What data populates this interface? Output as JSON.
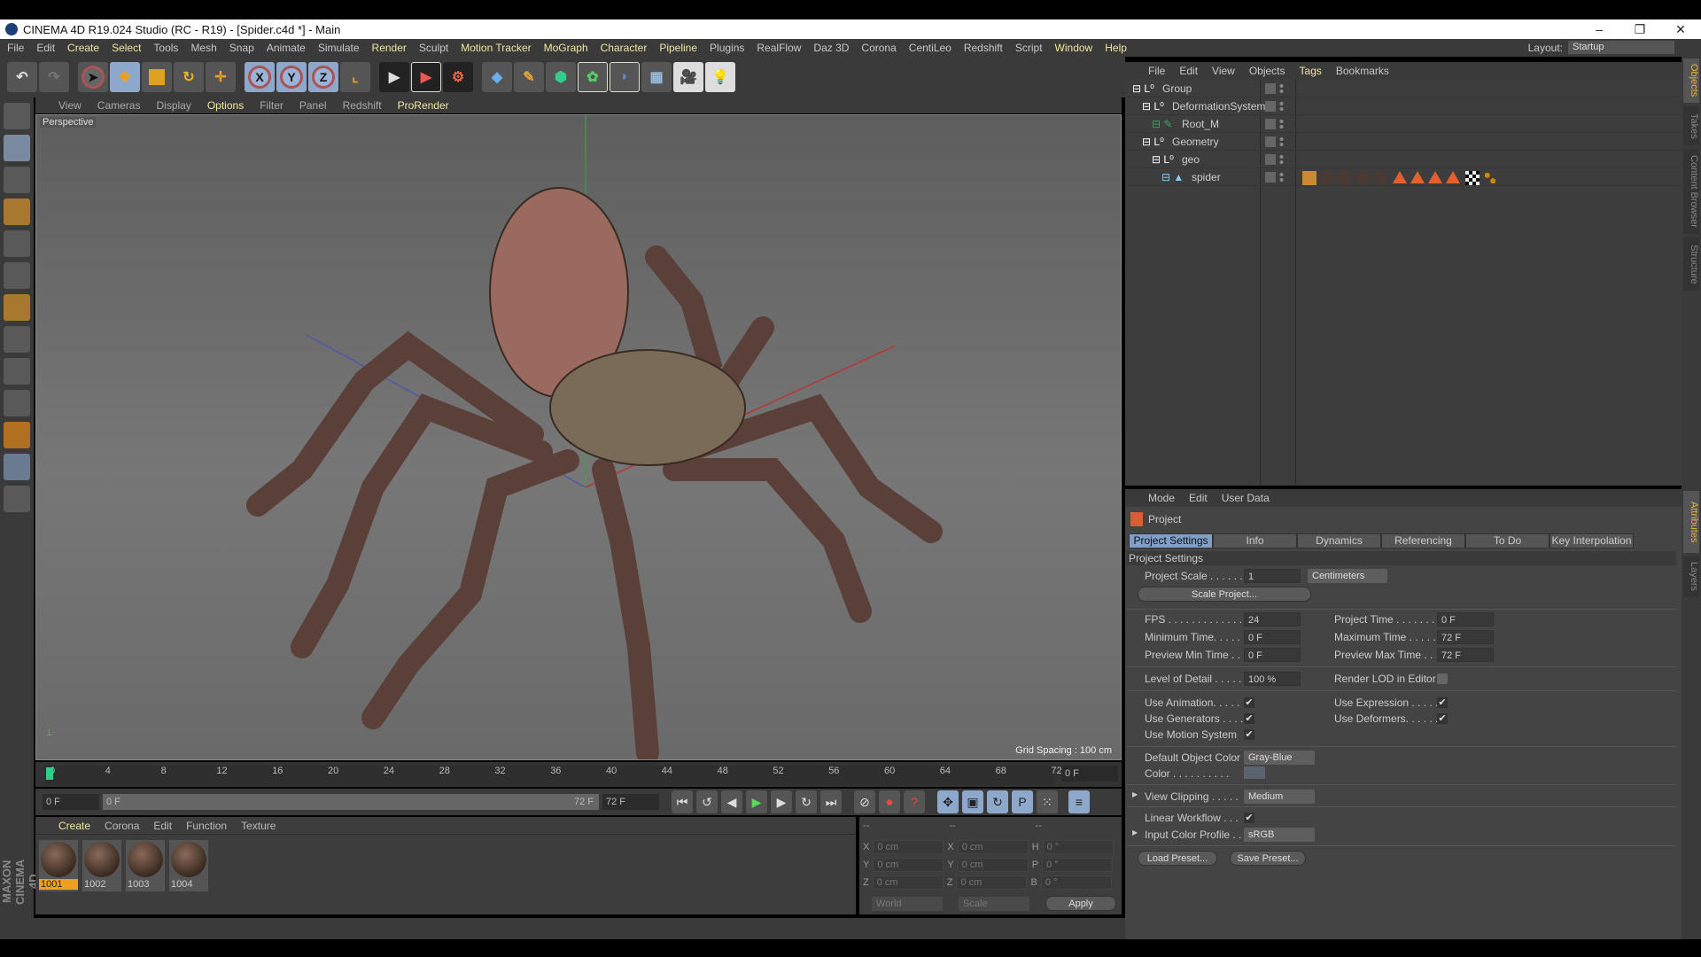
{
  "window": {
    "title": "CINEMA 4D R19.024 Studio (RC - R19) - [Spider.c4d *] - Main",
    "minimize": "–",
    "maximize": "❐",
    "close": "✕"
  },
  "menu": [
    "File",
    "Edit",
    "Create",
    "Select",
    "Tools",
    "Mesh",
    "Snap",
    "Animate",
    "Simulate",
    "Render",
    "Sculpt",
    "Motion Tracker",
    "MoGraph",
    "Character",
    "Pipeline",
    "Plugins",
    "RealFlow",
    "Daz 3D",
    "Corona",
    "CentiLeo",
    "Redshift",
    "Script",
    "Window",
    "Help"
  ],
  "layout": {
    "label": "Layout:",
    "value": "Startup"
  },
  "toolbar": {
    "x": "X",
    "y": "Y",
    "z": "Z"
  },
  "viewport": {
    "menu": [
      "View",
      "Cameras",
      "Display",
      "Options",
      "Filter",
      "Panel",
      "Redshift",
      "ProRender"
    ],
    "camera": "Perspective",
    "grid_spacing": "Grid Spacing : 100 cm"
  },
  "timeline": {
    "ticks": [
      "0",
      "4",
      "8",
      "12",
      "16",
      "20",
      "24",
      "28",
      "32",
      "36",
      "40",
      "44",
      "48",
      "52",
      "56",
      "60",
      "64",
      "68",
      "72"
    ],
    "current": "0 F",
    "start": "0 F",
    "range_start": "0 F",
    "range_end": "72 F",
    "end": "72 F"
  },
  "materials": {
    "menu": [
      "Create",
      "Corona",
      "Edit",
      "Function",
      "Texture"
    ],
    "items": [
      "1001",
      "1002",
      "1003",
      "1004"
    ]
  },
  "coordinates": {
    "header": [
      "--",
      "--",
      "--"
    ],
    "rows": [
      {
        "a": "X",
        "v1": "0 cm",
        "b": "X",
        "v2": "0 cm",
        "c": "H",
        "v3": "0 °"
      },
      {
        "a": "Y",
        "v1": "0 cm",
        "b": "Y",
        "v2": "0 cm",
        "c": "P",
        "v3": "0 °"
      },
      {
        "a": "Z",
        "v1": "0 cm",
        "b": "Z",
        "v2": "0 cm",
        "c": "B",
        "v3": "0 °"
      }
    ],
    "mode": "World",
    "size": "Scale",
    "apply": "Apply"
  },
  "objects": {
    "menu": [
      "File",
      "Edit",
      "View",
      "Objects",
      "Tags",
      "Bookmarks"
    ],
    "items": [
      {
        "name": "Group",
        "depth": 0
      },
      {
        "name": "DeformationSystem",
        "depth": 1
      },
      {
        "name": "Root_M",
        "depth": 2
      },
      {
        "name": "Geometry",
        "depth": 1
      },
      {
        "name": "geo",
        "depth": 2
      },
      {
        "name": "spider",
        "depth": 3
      }
    ]
  },
  "attributes": {
    "menu": [
      "Mode",
      "Edit",
      "User Data"
    ],
    "object": "Project",
    "tabs": [
      "Project Settings",
      "Info",
      "Dynamics",
      "Referencing",
      "To Do",
      "Key Interpolation"
    ],
    "section": "Project Settings",
    "project_scale": {
      "label": "Project Scale . . . . . .",
      "value": "1",
      "unit": "Centimeters"
    },
    "scale_btn": "Scale Project...",
    "fps": {
      "label": "FPS . . . . . . . . . . . . .",
      "value": "24"
    },
    "project_time": {
      "label": "Project Time . . . . . . . .",
      "value": "0 F"
    },
    "min_time": {
      "label": "Minimum Time. . . . .",
      "value": "0 F"
    },
    "max_time": {
      "label": "Maximum Time . . . . .",
      "value": "72 F"
    },
    "prev_min": {
      "label": "Preview Min Time . .",
      "value": "0 F"
    },
    "prev_max": {
      "label": "Preview Max Time . . .",
      "value": "72 F"
    },
    "lod": {
      "label": "Level of Detail . . . . .",
      "value": "100 %"
    },
    "render_lod": "Render LOD in Editor",
    "use_animation": "Use Animation. . . . .",
    "use_expression": "Use Expression . . . . .",
    "use_generators": "Use Generators . . . .",
    "use_deformers": "Use Deformers. . . . . .",
    "use_motion": "Use Motion System",
    "check": "✔",
    "default_color": {
      "label": "Default Object Color",
      "value": "Gray-Blue"
    },
    "color": {
      "label": "Color . . . . . . . . . .",
      "swatch": "#5a6470"
    },
    "view_clipping": {
      "label": "View Clipping . . . . .",
      "value": "Medium"
    },
    "linear_workflow": "Linear Workflow . . .",
    "input_profile": {
      "label": "Input Color Profile . .",
      "value": "sRGB"
    },
    "load_preset": "Load Preset...",
    "save_preset": "Save Preset..."
  },
  "side_tabs": {
    "top": [
      "Objects",
      "Takes",
      "Content Browser",
      "Structure"
    ],
    "bottom": [
      "Attributes",
      "Layers"
    ]
  },
  "logo": "MAXON CINEMA 4D"
}
